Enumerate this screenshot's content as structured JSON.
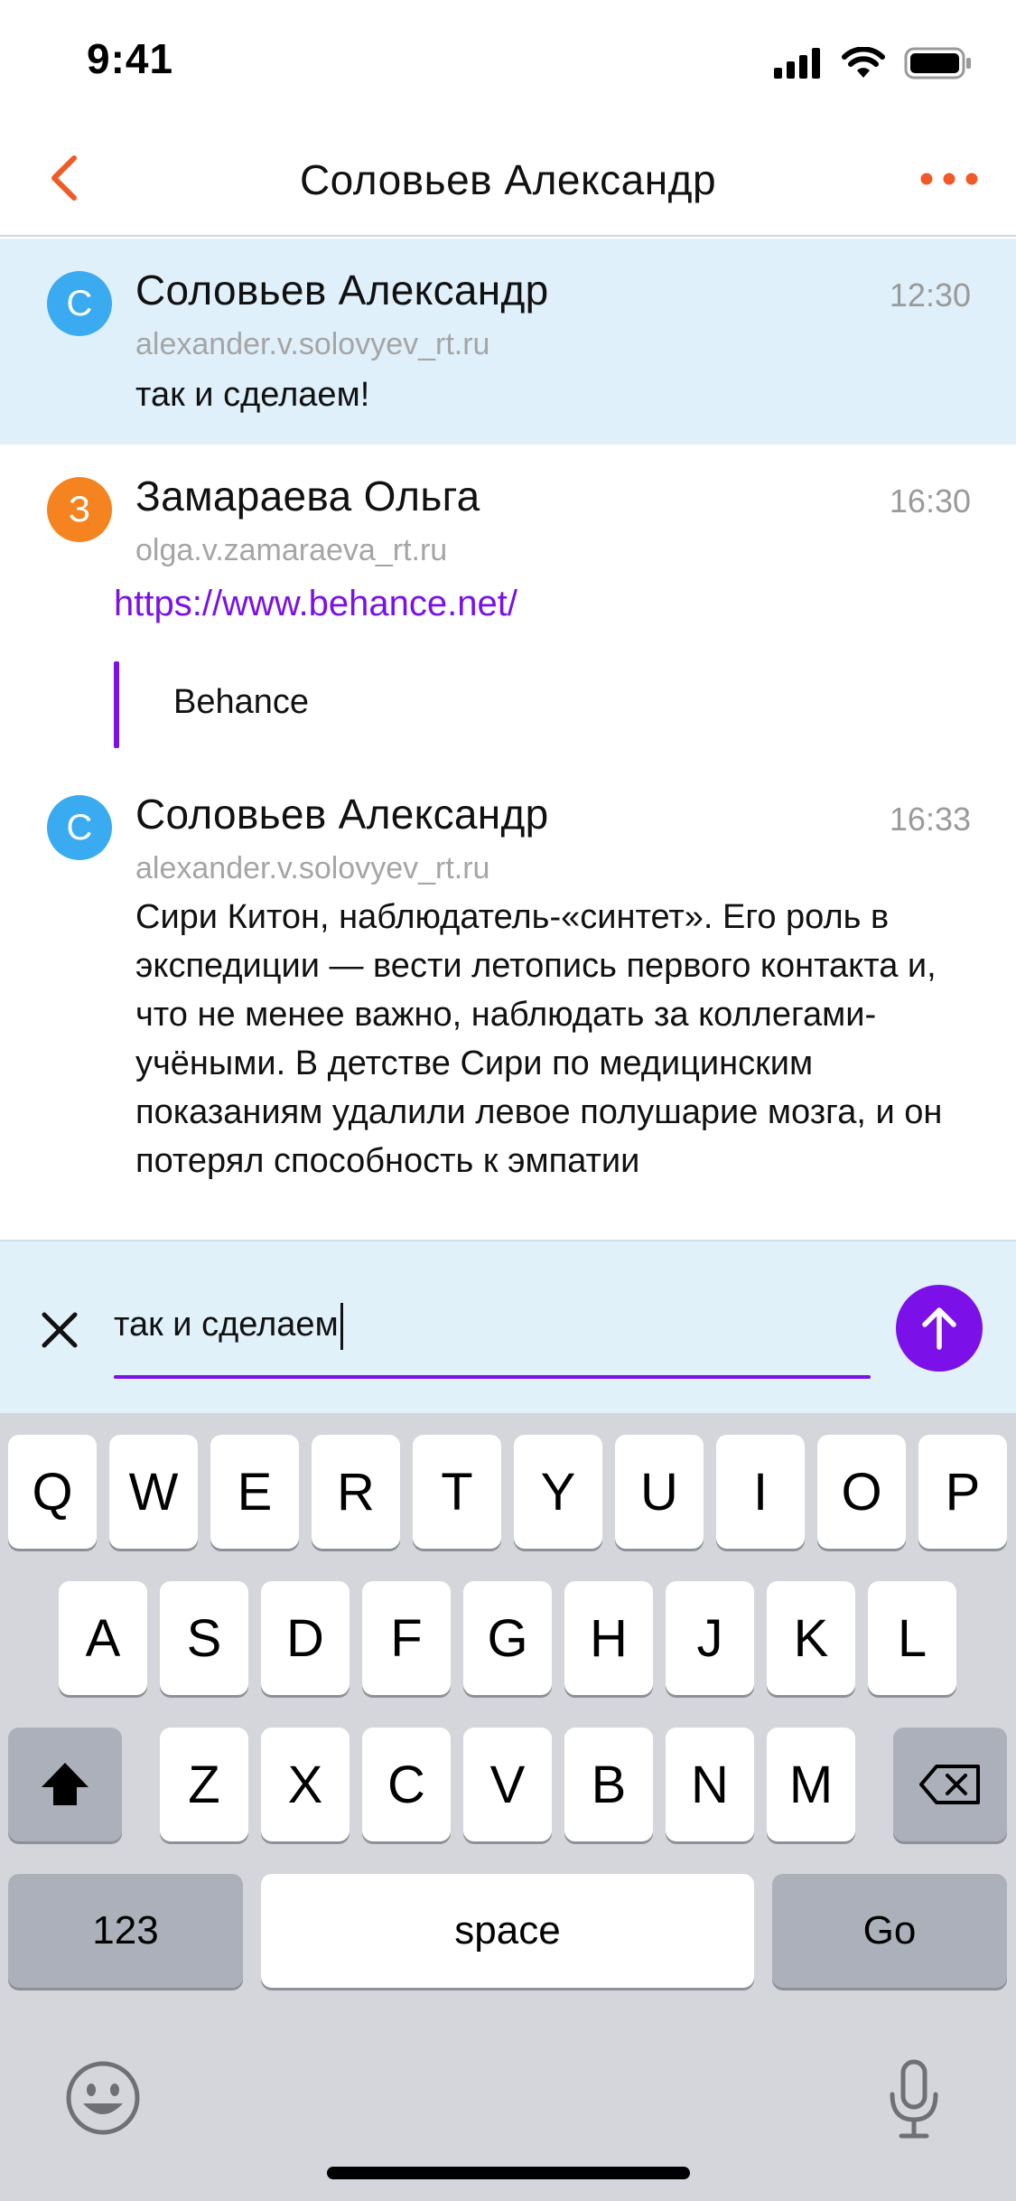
{
  "status_bar": {
    "time": "9:41"
  },
  "nav": {
    "title": "Соловьев Александр"
  },
  "messages": [
    {
      "avatar_letter": "С",
      "avatar_color": "#3aabf0",
      "sender": "Соловьев Александр",
      "time": "12:30",
      "email": "alexander.v.solovyev_rt.ru",
      "text": "так и сделаем!"
    },
    {
      "avatar_letter": "З",
      "avatar_color": "#f5831f",
      "sender": "Замараева Ольга",
      "time": "16:30",
      "email": "olga.v.zamaraeva_rt.ru",
      "link": "https://www.behance.net/",
      "quote": "Behance"
    },
    {
      "avatar_letter": "С",
      "avatar_color": "#3aabf0",
      "sender": "Соловьев Александр",
      "time": "16:33",
      "email": "alexander.v.solovyev_rt.ru",
      "text": "Сири Китон, наблюдатель-«синтет». Его роль в экспедиции — вести летопись первого контакта и, что не менее важно, наблюдать за коллегами-учёными. В детстве Сири по медицинским показаниям удалили левое полушарие мозга, и он потерял способность к эмпатии"
    }
  ],
  "composer": {
    "value": "так и сделаем"
  },
  "keyboard": {
    "row1": [
      "Q",
      "W",
      "E",
      "R",
      "T",
      "Y",
      "U",
      "I",
      "O",
      "P"
    ],
    "row2": [
      "A",
      "S",
      "D",
      "F",
      "G",
      "H",
      "J",
      "K",
      "L"
    ],
    "row3": [
      "Z",
      "X",
      "C",
      "V",
      "B",
      "N",
      "M"
    ],
    "numbers_label": "123",
    "space_label": "space",
    "go_label": "Go"
  },
  "colors": {
    "accent": "#7b11e8",
    "nav_accent": "#f05a28",
    "highlight": "#dff0fa"
  }
}
